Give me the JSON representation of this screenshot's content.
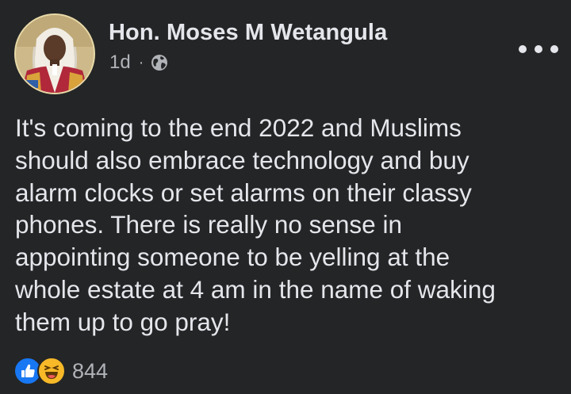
{
  "post": {
    "author": "Hon. Moses M Wetangula",
    "timestamp": "1d",
    "separator": "·",
    "audience_icon": "globe-icon",
    "more_icon": "more-horizontal-icon",
    "text": "It's coming to the end 2022 and Muslims\nshould also embrace technology and buy\nalarm clocks or set alarms on their classy\nphones. There is really no sense in\nappointing someone to be yelling at the\nwhole estate at 4 am in the name of waking\nthem up to go pray!",
    "reactions": {
      "icons": [
        "like-reaction-icon",
        "haha-reaction-icon"
      ],
      "count": "844"
    }
  },
  "colors": {
    "background": "#242526",
    "primary_text": "#e4e6eb",
    "secondary_text": "#b0b3b8",
    "like_blue": "#1877f2",
    "haha_yellow": "#f7b928"
  }
}
